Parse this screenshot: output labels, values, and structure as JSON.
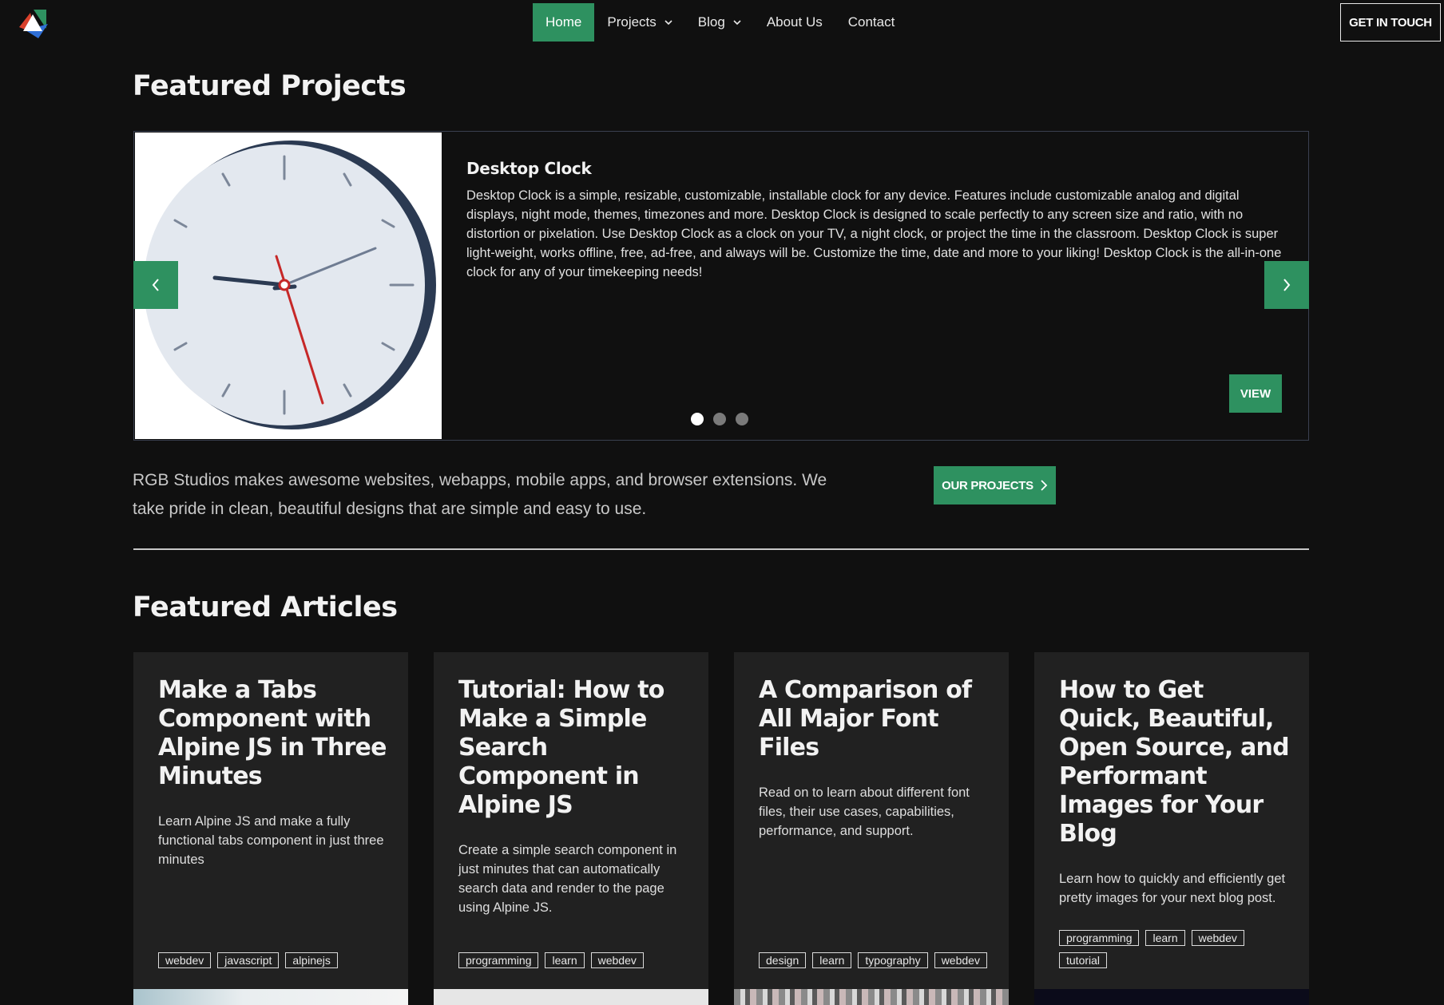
{
  "nav": {
    "items": [
      {
        "label": "Home",
        "active": true
      },
      {
        "label": "Projects",
        "dropdown": true
      },
      {
        "label": "Blog",
        "dropdown": true
      },
      {
        "label": "About Us"
      },
      {
        "label": "Contact"
      }
    ],
    "cta_label": "GET IN TOUCH"
  },
  "featured_projects": {
    "title": "Featured Projects",
    "slide": {
      "title": "Desktop Clock",
      "description": "Desktop Clock is a simple, resizable, customizable, installable clock for any device. Features include customizable analog and digital displays, night mode, themes, timezones and more. Desktop Clock is designed to scale perfectly to any screen size and ratio, with no distortion or pixelation. Use Desktop Clock as a clock on your TV, a night clock, or project the time in the classroom. Desktop Clock is super light-weight, works offline, free, ad-free, and always will be. Customize the time, date and more to your liking! Desktop Clock is the all-in-one clock for any of your timekeeping needs!",
      "view_label": "VIEW"
    },
    "dots": 3,
    "active_dot": 1
  },
  "intro": {
    "text": "RGB Studios makes awesome websites, webapps, mobile apps, and browser extensions. We take pride in clean, beautiful designs that are simple and easy to use.",
    "button_label": "OUR PROJECTS"
  },
  "featured_articles": {
    "title": "Featured Articles",
    "cards": [
      {
        "title": "Make a Tabs Component with Alpine JS in Three Minutes",
        "description": "Learn Alpine JS and make a fully functional tabs component in just three minutes",
        "tags": [
          "webdev",
          "javascript",
          "alpinejs"
        ]
      },
      {
        "title": "Tutorial: How to Make a Simple Search Component in Alpine JS",
        "description": "Create a simple search component in just minutes that can automatically search data and render to the page using Alpine JS.",
        "tags": [
          "programming",
          "learn",
          "webdev"
        ]
      },
      {
        "title": "A Comparison of All Major Font Files",
        "description": "Read on to learn about different font files, their use cases, capabilities, performance, and support.",
        "tags": [
          "design",
          "learn",
          "typography",
          "webdev"
        ]
      },
      {
        "title": "How to Get Quick, Beautiful, Open Source, and Performant Images for Your Blog",
        "description": "Learn how to quickly and efficiently get pretty images for your next blog post.",
        "tags": [
          "programming",
          "learn",
          "webdev",
          "tutorial"
        ]
      }
    ]
  },
  "colors": {
    "accent": "#2e9160",
    "background": "#101010",
    "card": "#212121"
  }
}
